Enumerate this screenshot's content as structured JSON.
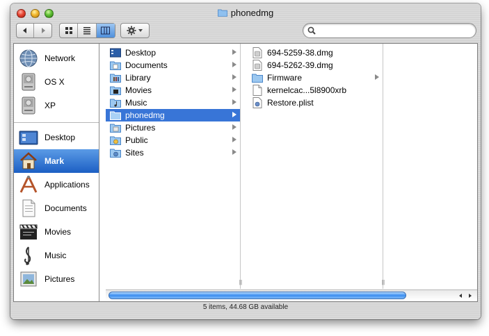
{
  "window": {
    "title": "phonedmg"
  },
  "search": {
    "value": ""
  },
  "sidebar": {
    "devices": [
      {
        "label": "Network",
        "icon": "globe-icon"
      },
      {
        "label": "OS X",
        "icon": "hard-drive-icon"
      },
      {
        "label": "XP",
        "icon": "hard-drive-icon"
      }
    ],
    "places": [
      {
        "label": "Desktop",
        "icon": "desktop-icon"
      },
      {
        "label": "Mark",
        "icon": "home-icon",
        "selected": true
      },
      {
        "label": "Applications",
        "icon": "applications-icon"
      },
      {
        "label": "Documents",
        "icon": "documents-icon"
      },
      {
        "label": "Movies",
        "icon": "movies-icon"
      },
      {
        "label": "Music",
        "icon": "music-icon"
      },
      {
        "label": "Pictures",
        "icon": "pictures-icon"
      }
    ]
  },
  "columns": {
    "home": [
      {
        "name": "Desktop",
        "icon": "desktop-folder-icon",
        "has_children": true
      },
      {
        "name": "Documents",
        "icon": "documents-folder-icon",
        "has_children": true
      },
      {
        "name": "Library",
        "icon": "library-folder-icon",
        "has_children": true
      },
      {
        "name": "Movies",
        "icon": "movies-folder-icon",
        "has_children": true
      },
      {
        "name": "Music",
        "icon": "music-folder-icon",
        "has_children": true
      },
      {
        "name": "phonedmg",
        "icon": "folder-icon",
        "has_children": true,
        "selected": true
      },
      {
        "name": "Pictures",
        "icon": "pictures-folder-icon",
        "has_children": true
      },
      {
        "name": "Public",
        "icon": "public-folder-icon",
        "has_children": true
      },
      {
        "name": "Sites",
        "icon": "sites-folder-icon",
        "has_children": true
      }
    ],
    "phonedmg": [
      {
        "name": "694-5259-38.dmg",
        "icon": "dmg-file-icon",
        "has_children": false
      },
      {
        "name": "694-5262-39.dmg",
        "icon": "dmg-file-icon",
        "has_children": false
      },
      {
        "name": "Firmware",
        "icon": "folder-icon",
        "has_children": true
      },
      {
        "name": "kernelcac...5l8900xrb",
        "icon": "document-icon",
        "has_children": false
      },
      {
        "name": "Restore.plist",
        "icon": "plist-file-icon",
        "has_children": false
      }
    ]
  },
  "status_bar": {
    "text": "5 items, 44.68 GB available"
  },
  "colors": {
    "selection": "#3875d7",
    "sidebar_selection": "#1c5fc4"
  }
}
